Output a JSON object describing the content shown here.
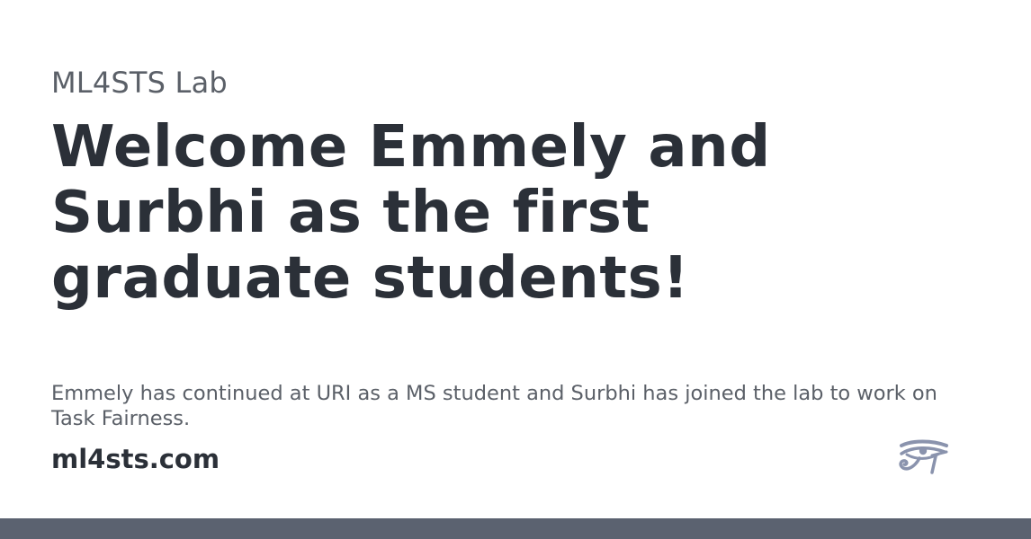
{
  "card": {
    "site_name": "ML4STS Lab",
    "title": "Welcome Emmely and Surbhi as the first graduate students!",
    "description": "Emmely has continued at URI as a MS student and Surbhi has joined the lab to work on Task Fairness.",
    "site_url": "ml4sts.com",
    "logo_icon": "eye-of-horus-icon"
  },
  "colors": {
    "heading": "#2b3038",
    "muted_text": "#5b6068",
    "logo": "#8a93ad",
    "bottom_bar": "#5b6270",
    "background": "#ffffff"
  }
}
